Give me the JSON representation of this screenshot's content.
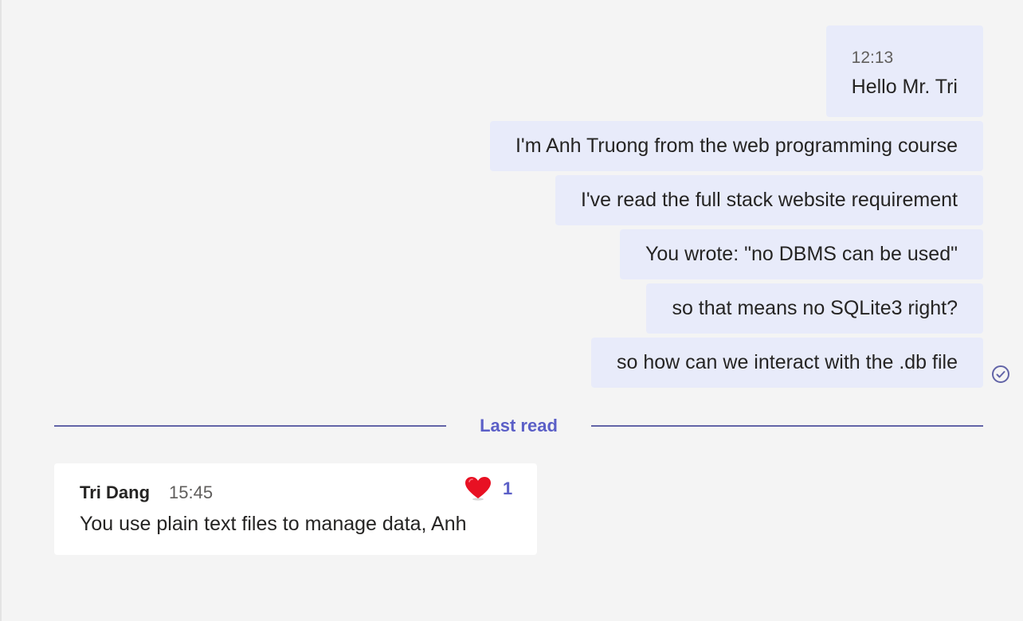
{
  "conversation": {
    "sent_messages": [
      {
        "time": "12:13",
        "text": "Hello Mr. Tri"
      },
      {
        "text": "I'm Anh Truong from the web programming course"
      },
      {
        "text": "I've read the full stack website requirement"
      },
      {
        "text": "You wrote: \"no DBMS can be used\""
      },
      {
        "text": "so that means no SQLite3 right?"
      },
      {
        "text": "so how can we interact with the .db file"
      }
    ],
    "read_receipt_icon": "check-circle-icon",
    "divider_label": "Last read",
    "received": {
      "sender": "Tri Dang",
      "time": "15:45",
      "text": "You use plain text files to manage data, Anh",
      "reaction": {
        "icon": "heart-icon",
        "count": "1"
      }
    }
  },
  "colors": {
    "background": "#f4f4f4",
    "sent_bubble": "#e8ebfa",
    "received_bubble": "#ffffff",
    "accent": "#5b5fc7",
    "heart": "#e81123"
  }
}
